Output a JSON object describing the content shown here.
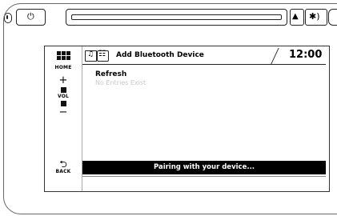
{
  "head_unit": {
    "power_symbol": "⏻",
    "eject_symbol": "▲",
    "aux_symbol": "✱)"
  },
  "sidebar": {
    "home_label": "HOME",
    "vol_label": "VOL",
    "plus_symbol": "+",
    "minus_symbol": "−",
    "back_symbol": "⮌",
    "back_label": "BACK"
  },
  "screen": {
    "title": "Add Bluetooth Device",
    "clock": "12:00",
    "list": {
      "refresh_label": "Refresh",
      "empty_text": "No Entries Exist"
    },
    "status_text": "Pairing with your device..."
  }
}
